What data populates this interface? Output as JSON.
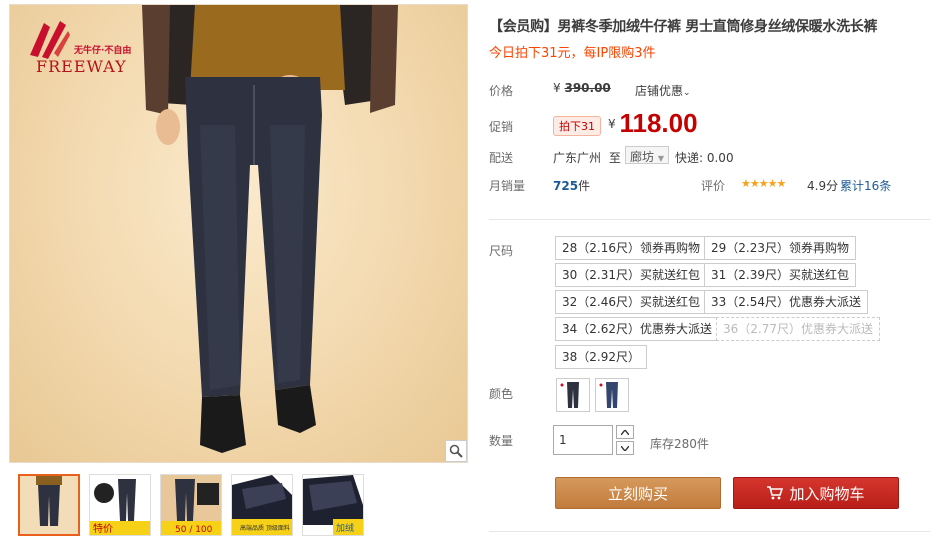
{
  "brand": {
    "name": "FREEWAY",
    "slogan": "无牛仔·不自由"
  },
  "product": {
    "title": "【会员购】男裤冬季加绒牛仔裤 男士直筒修身丝绒保暖水洗长裤",
    "subtitle": "今日拍下31元，每IP限购3件",
    "price_label": "价格",
    "currency": "¥",
    "original_price": "390.00",
    "shop_promo": "店铺优惠",
    "promo_label": "促销",
    "promo_tag": "拍下31",
    "promo_price": "118.00",
    "ship_label": "配送",
    "ship_from": "广东广州",
    "ship_to_word": "至",
    "ship_to": "廊坊",
    "express": "快递: 0.00",
    "sales_label": "月销量",
    "sales_count": "725",
    "sales_unit": "件",
    "rating_label": "评价",
    "rating_stars": 5,
    "rating_score": "4.9分",
    "reviews": "累计16条"
  },
  "sku": {
    "size_label": "尺码",
    "sizes": [
      "28（2.16尺）领券再购物",
      "29（2.23尺）领券再购物",
      "30（2.31尺）买就送红包",
      "31（2.39尺）买就送红包",
      "32（2.46尺）买就送红包",
      "33（2.54尺）优惠券大派送",
      "34（2.62尺）优惠券大派送",
      "36（2.77尺）优惠券大派送",
      "38（2.92尺）"
    ],
    "color_label": "颜色",
    "qty_label": "数量",
    "qty_value": "1",
    "stock": "库存280件"
  },
  "actions": {
    "buy_now": "立刻购买",
    "add_to_cart": "加入购物车"
  },
  "thumbnails": [
    {
      "caption": ""
    },
    {
      "caption": "特价"
    },
    {
      "caption": "50 / 100"
    },
    {
      "caption": "高端品质 顶级面料"
    },
    {
      "caption": "加绒"
    }
  ],
  "colors": {
    "price_red": "#c40000",
    "accent_orange": "#ff4400",
    "buy_btn": "#c8874a",
    "cart_btn": "#c4271f",
    "link_blue": "#1d5b96"
  }
}
